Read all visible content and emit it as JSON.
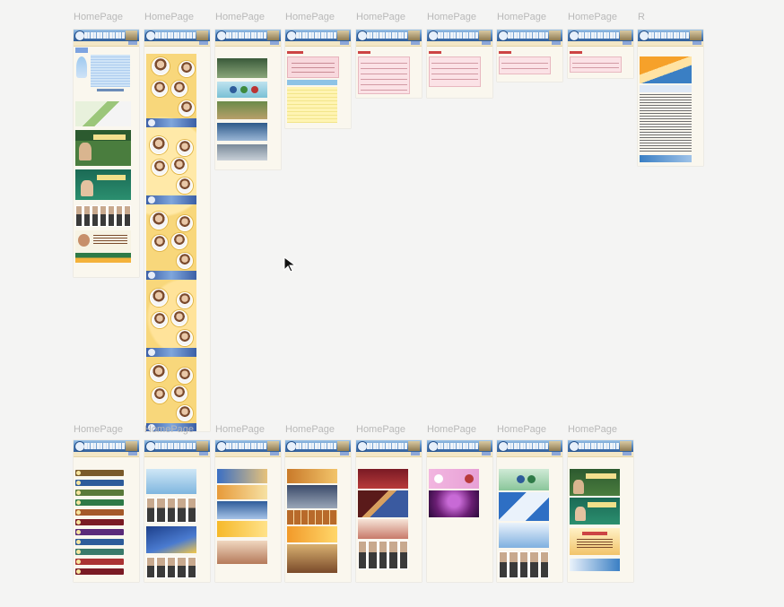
{
  "canvas": {
    "background": "#f4f4f3",
    "frame_label_color": "#b9b9b9"
  },
  "frame_labels": {
    "row1": [
      "HomePage",
      "HomePage",
      "HomePage",
      "HomePage",
      "HomePage",
      "HomePage",
      "HomePage",
      "HomePage",
      "R"
    ],
    "row2": [
      "HomePage",
      "HomePage",
      "HomePage",
      "HomePage",
      "HomePage",
      "HomePage",
      "HomePage",
      "HomePage"
    ]
  },
  "icons": {
    "cursor": "arrow-pointer-icon"
  },
  "colors": {
    "header_blue": "#2f5e9b",
    "page_cream": "#faf7ee",
    "accent_yellow": "#f8d77b",
    "accent_pink": "#f8d8dd",
    "accent_green": "#2e7a47",
    "accent_purple": "#6a1e73",
    "accent_maroon": "#7a1a24"
  }
}
